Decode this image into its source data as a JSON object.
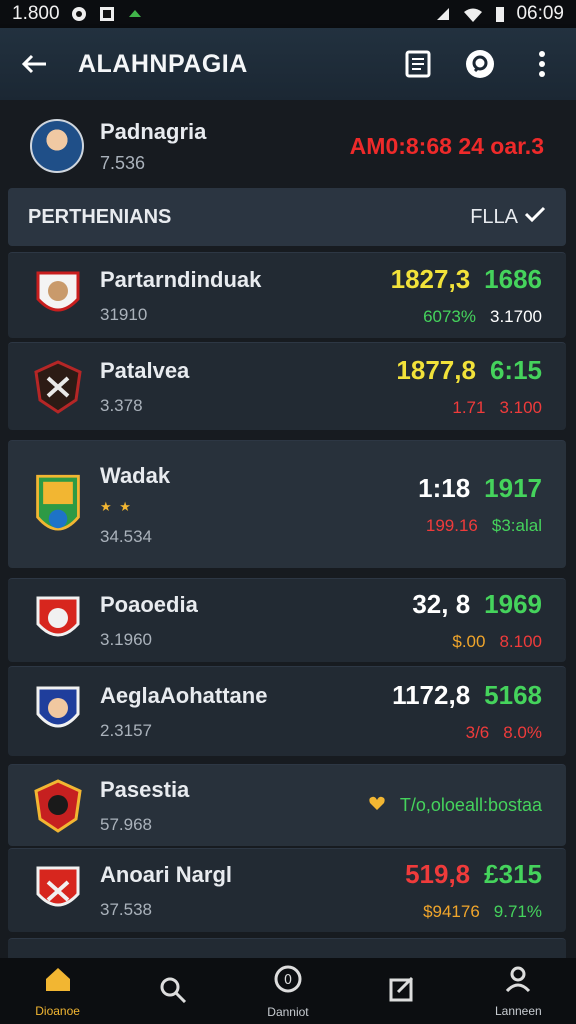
{
  "status_bar": {
    "time_left": "1.800",
    "time_right": "06:09",
    "icons": [
      "notification-icon",
      "app-icon",
      "vibrate-icon",
      "wifi-icon",
      "signal-icon",
      "battery-icon"
    ]
  },
  "app_bar": {
    "title": "ALAHNPAGIA",
    "icons": [
      "back-arrow-icon",
      "document-icon",
      "chat-icon",
      "more-vert-icon"
    ]
  },
  "profile": {
    "name": "Padnagria",
    "sub": "7.536",
    "alert": "AM0:8:68 24 oar.3"
  },
  "section": {
    "title": "PERTHENIANS",
    "filter_label": "FLLA"
  },
  "teams": [
    {
      "name": "Partarndinduak",
      "meta": "31910",
      "main_left": "1827,3",
      "main_right": "1686",
      "sub_left": "6073%",
      "sub_right": "3.1700"
    },
    {
      "name": "Patalvea",
      "meta": "3.378",
      "main_left": "1877,8",
      "main_right": "6:15",
      "sub_left": "1.71",
      "sub_right": "3.100"
    },
    {
      "name": "Wadak",
      "meta": "34.534",
      "stars": "★ ★",
      "main_left": "1:18",
      "main_right": "1917",
      "sub_left": "199.16",
      "sub_right": "$3:alal"
    },
    {
      "name": "Poaoedia",
      "meta": "3.1960",
      "main_left": "32, 8",
      "main_right": "1969",
      "sub_left": "$.00",
      "sub_right": "8.100"
    },
    {
      "name": "AeglaAohattane",
      "meta": "2.3157",
      "main_left": "1172,8",
      "main_right": "5168",
      "sub_left": "3/6",
      "sub_right": "8.0%"
    },
    {
      "name": "Pasestia",
      "meta": "57.968",
      "note": "T/o,oloeall:bostaa"
    },
    {
      "name": "Anoari Nargl",
      "meta": "37.538",
      "main_left": "519,8",
      "main_right": "£315",
      "sub_left": "$94176",
      "sub_right": "9.71%"
    }
  ],
  "bottom_nav": [
    {
      "label": "Dioanoe",
      "icon": "home-icon"
    },
    {
      "label": "",
      "icon": "search-icon"
    },
    {
      "label": "Danniot",
      "icon": "circle-zero-icon"
    },
    {
      "label": "",
      "icon": "edit-icon"
    },
    {
      "label": "Lanneen",
      "icon": "profile-icon"
    }
  ]
}
